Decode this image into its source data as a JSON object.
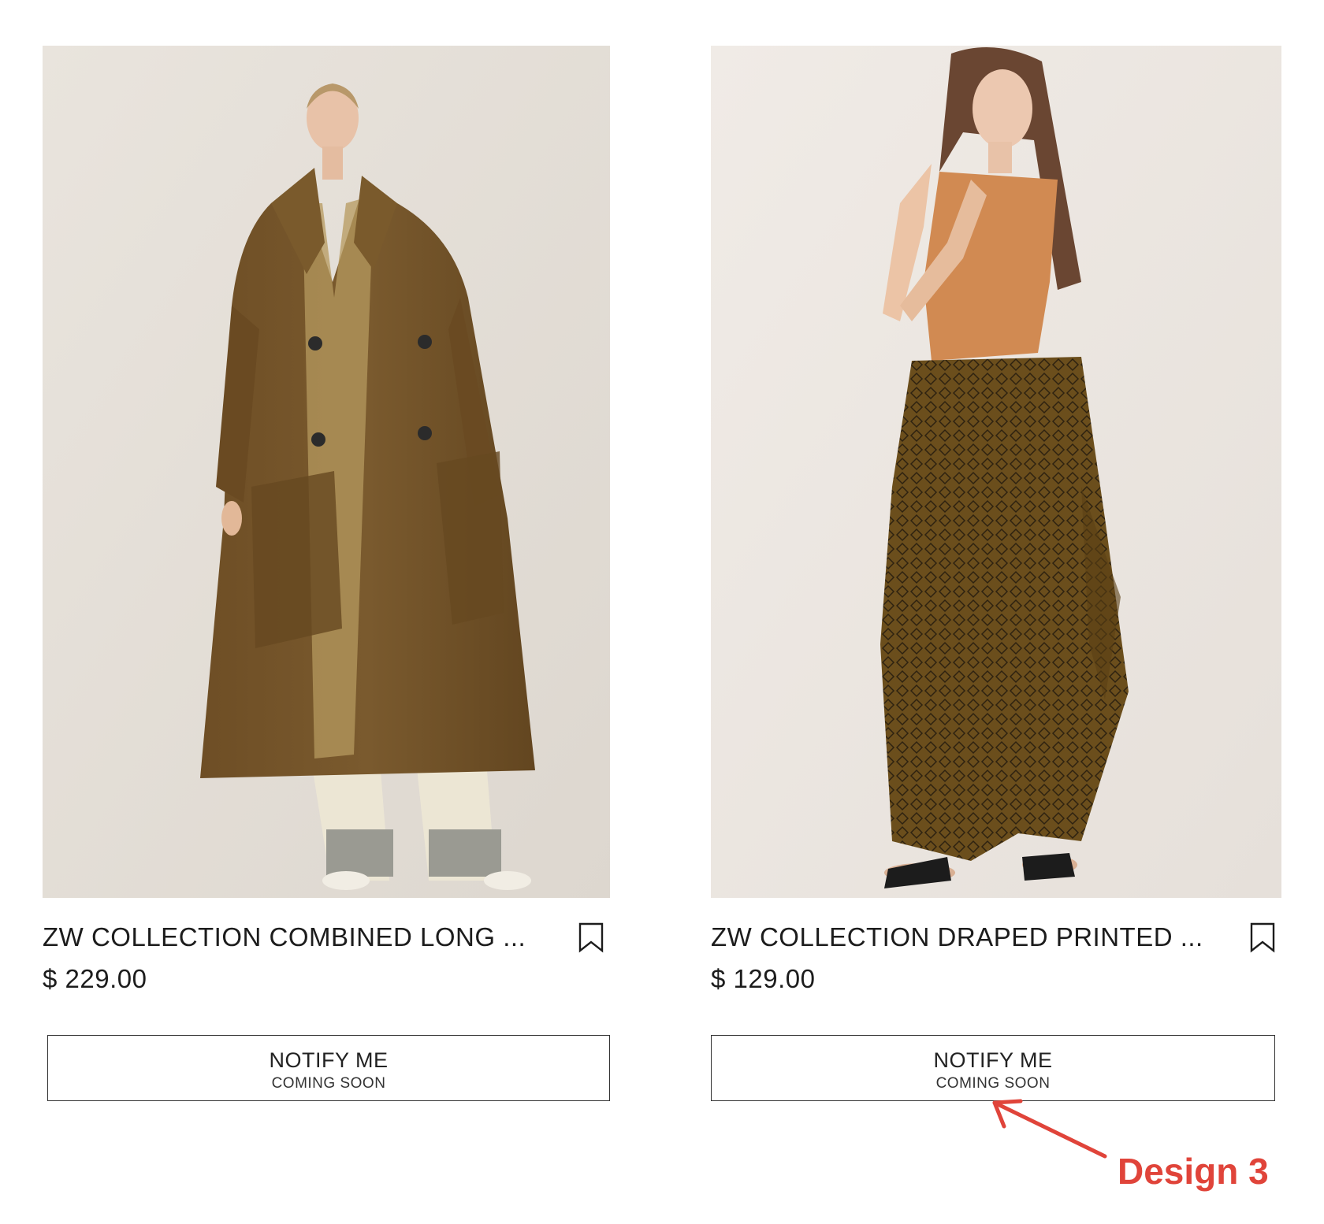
{
  "products": [
    {
      "title": "ZW COLLECTION COMBINED LONG ...",
      "price": "$ 229.00",
      "notify_label": "NOTIFY ME",
      "notify_sub": "COMING SOON",
      "image": "model-in-brown-double-breasted-long-coat",
      "bookmark_icon": "bookmark-icon"
    },
    {
      "title": "ZW COLLECTION DRAPED PRINTED ...",
      "price": "$ 129.00",
      "notify_label": "NOTIFY ME",
      "notify_sub": "COMING SOON",
      "image": "model-in-orange-bodysuit-and-printed-draped-trousers",
      "bookmark_icon": "bookmark-icon"
    }
  ],
  "annotation": {
    "text": "Design 3",
    "color": "#e0443a"
  },
  "colors": {
    "text": "#1c1c1c",
    "border": "#333333",
    "background": "#ffffff"
  }
}
